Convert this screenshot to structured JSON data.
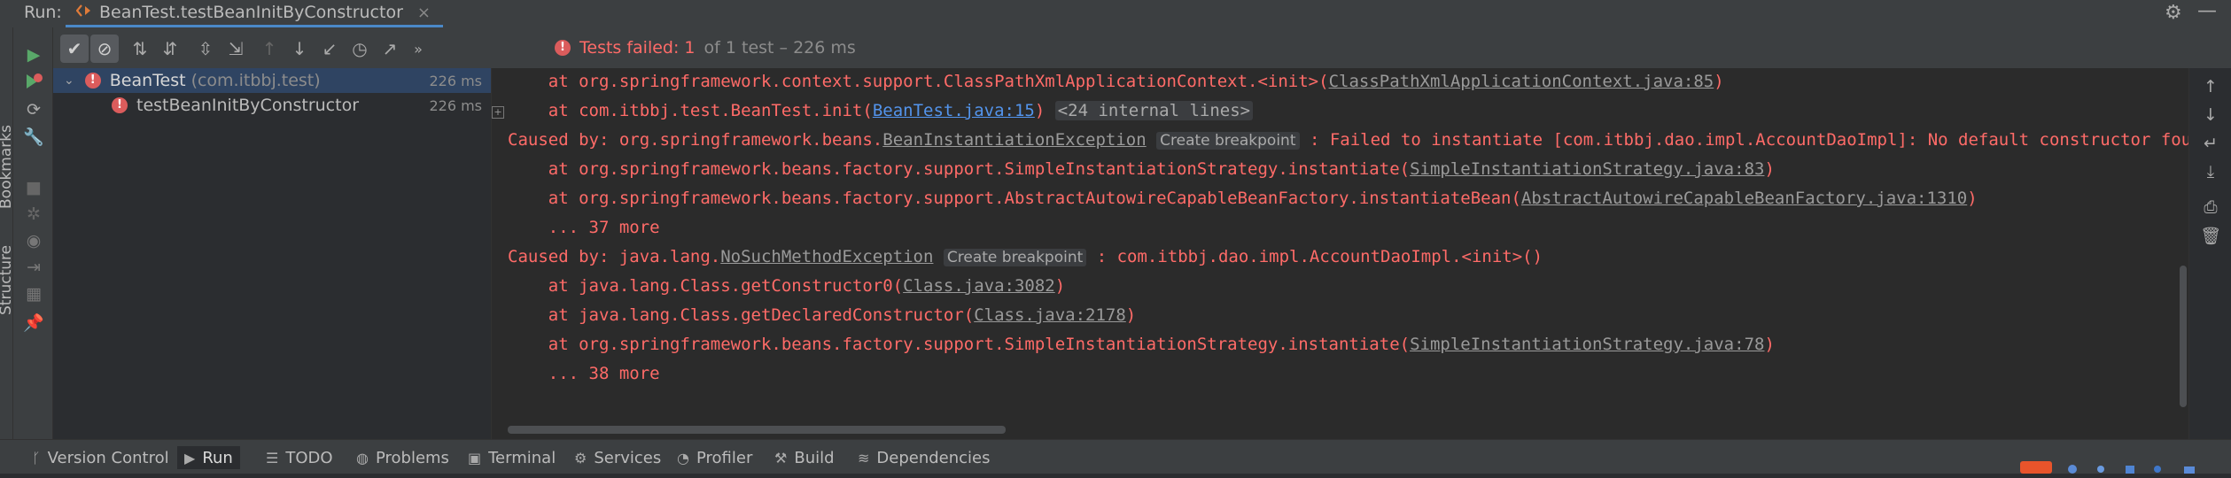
{
  "header": {
    "run_label": "Run:",
    "tab_label": "BeanTest.testBeanInitByConstructor",
    "tab_close": "×",
    "gear_icon": "gear-icon",
    "minimize_icon": "minimize-icon"
  },
  "left_stripe": {
    "bookmarks_label": "Bookmarks",
    "structure_label": "Structure"
  },
  "status": {
    "icon": "error-icon",
    "failed_text": "Tests failed: 1",
    "detail_text": "of 1 test – 226 ms"
  },
  "tree": {
    "rows": [
      {
        "name": "BeanTest",
        "pkg": "(com.itbbj.test)",
        "duration": "226 ms",
        "state": "failed",
        "selected": true
      },
      {
        "name": "testBeanInitByConstructor",
        "duration": "226 ms",
        "state": "failed",
        "selected": false
      }
    ]
  },
  "console": {
    "line1_pre": "    at org.springframework.context.support.ClassPathXmlApplicationContext.<init>(",
    "line1_link": "ClassPathXmlApplicationContext.java:85",
    "line1_post": ")",
    "line2_pre": "    at com.itbbj.test.BeanTest.init(",
    "line2_link": "BeanTest.java:15",
    "line2_mid": ") ",
    "line2_chip": "<24 internal lines>",
    "line3_pre": "Caused by: org.springframework.beans.",
    "line3_ex": "BeanInstantiationException",
    "line3_hint": "Create breakpoint",
    "line3_post": ": Failed to instantiate [com.itbbj.dao.impl.AccountDaoImpl]: No default constructor found; nested exception is java.lang.NoSuchMethodException",
    "line4_pre": "    at org.springframework.beans.factory.support.SimpleInstantiationStrategy.instantiate(",
    "line4_link": "SimpleInstantiationStrategy.java:83",
    "line4_post": ")",
    "line5_pre": "    at org.springframework.beans.factory.support.AbstractAutowireCapableBeanFactory.instantiateBean(",
    "line5_link": "AbstractAutowireCapableBeanFactory.java:1310",
    "line5_post": ")",
    "line6": "    ... 37 more",
    "line7_pre": "Caused by: java.lang.",
    "line7_ex": "NoSuchMethodException",
    "line7_hint": "Create breakpoint",
    "line7_post": ": com.itbbj.dao.impl.AccountDaoImpl.<init>()",
    "line8_pre": "    at java.lang.Class.getConstructor0(",
    "line8_link": "Class.java:3082",
    "line8_post": ")",
    "line9_pre": "    at java.lang.Class.getDeclaredConstructor(",
    "line9_link": "Class.java:2178",
    "line9_post": ")",
    "line10_pre": "    at org.springframework.beans.factory.support.SimpleInstantiationStrategy.instantiate(",
    "line10_link": "SimpleInstantiationStrategy.java:78",
    "line10_post": ")",
    "line11": "    ... 38 more"
  },
  "bottom_tabs": [
    {
      "label": "Version Control",
      "icon": "branch-icon"
    },
    {
      "label": "Run",
      "icon": "run-icon",
      "active": true
    },
    {
      "label": "TODO",
      "icon": "list-icon"
    },
    {
      "label": "Problems",
      "icon": "warning-icon"
    },
    {
      "label": "Terminal",
      "icon": "terminal-icon"
    },
    {
      "label": "Services",
      "icon": "services-icon"
    },
    {
      "label": "Profiler",
      "icon": "profiler-icon"
    },
    {
      "label": "Build",
      "icon": "hammer-icon"
    },
    {
      "label": "Dependencies",
      "icon": "layers-icon"
    }
  ],
  "colors": {
    "error": "#ff6b68",
    "link": "#5394ec",
    "selection": "#2f4462",
    "accent": "#4a88c7"
  }
}
